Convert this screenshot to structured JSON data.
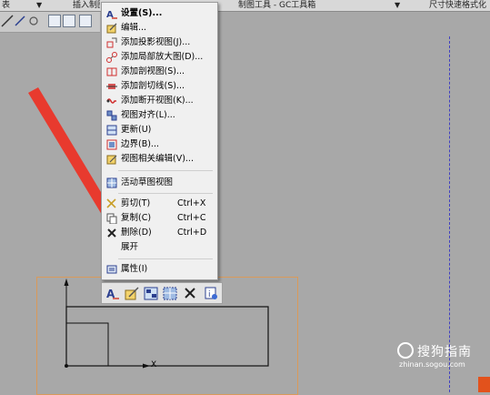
{
  "toolbar_top": {
    "seg1": "表",
    "seg2": "插入制图",
    "seg3": "制图工具 - GC工具箱",
    "seg4": "尺寸快速格式化"
  },
  "context_menu": {
    "items": [
      {
        "icon": "settings-icon",
        "label": "设置(S)...",
        "shortcut": ""
      },
      {
        "icon": "edit-icon",
        "label": "编辑...",
        "shortcut": ""
      },
      {
        "icon": "projected-view-icon",
        "label": "添加投影视图(J)...",
        "shortcut": ""
      },
      {
        "icon": "detail-view-icon",
        "label": "添加局部放大图(D)...",
        "shortcut": ""
      },
      {
        "icon": "section-view-icon",
        "label": "添加剖视图(S)...",
        "shortcut": ""
      },
      {
        "icon": "section-line-icon",
        "label": "添加剖切线(S)...",
        "shortcut": ""
      },
      {
        "icon": "break-view-icon",
        "label": "添加断开视图(K)...",
        "shortcut": ""
      },
      {
        "icon": "align-view-icon",
        "label": "视图对齐(L)...",
        "shortcut": ""
      },
      {
        "icon": "update-icon",
        "label": "更新(U)",
        "shortcut": ""
      },
      {
        "icon": "boundary-icon",
        "label": "边界(B)...",
        "shortcut": ""
      },
      {
        "icon": "view-dependent-edit-icon",
        "label": "视图相关编辑(V)...",
        "shortcut": ""
      },
      {
        "icon": "active-sketch-icon",
        "label": "活动草图视图",
        "shortcut": ""
      },
      {
        "icon": "cut-icon",
        "label": "剪切(T)",
        "shortcut": "Ctrl+X"
      },
      {
        "icon": "copy-icon",
        "label": "复制(C)",
        "shortcut": "Ctrl+C"
      },
      {
        "icon": "delete-icon",
        "label": "删除(D)",
        "shortcut": "Ctrl+D"
      },
      {
        "icon": "expand-icon",
        "label": "展开",
        "shortcut": ""
      },
      {
        "icon": "properties-icon",
        "label": "属性(I)",
        "shortcut": ""
      }
    ]
  },
  "drawing": {
    "axis_x_label": "X"
  },
  "watermark": {
    "brand": "搜狗指南",
    "url": "zhinan.sogou.com"
  },
  "colors": {
    "background": "#a8a8a8",
    "arrow": "#e83a2e",
    "sheet_border": "#d99a5a",
    "guide": "#4040c0"
  }
}
